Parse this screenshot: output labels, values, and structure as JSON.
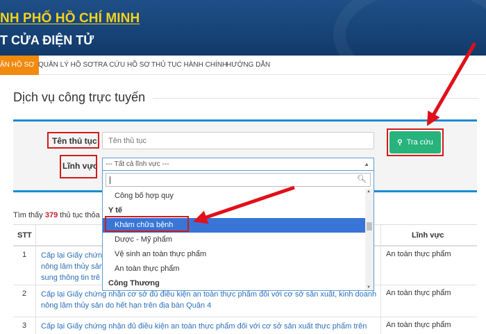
{
  "header": {
    "line1": "NH PHỐ HỒ CHÍ MINH",
    "line2": "T CỬA ĐIỆN TỬ"
  },
  "nav": {
    "items": [
      "ẬN HỒ SƠ",
      "QUẢN LÝ HỒ SƠ",
      "TRA CỨU HỒ SƠ",
      "THỦ TỤC HÀNH CHÍNH",
      "HƯỚNG DẪN"
    ],
    "active_color": "#f18a0e"
  },
  "page_title": "Dịch vụ công trực tuyến",
  "search": {
    "procedure_label": "Tên thủ tục",
    "procedure_placeholder": "Tên thủ tục",
    "field_label": "Lĩnh vực",
    "field_selected": "--- Tất cả lĩnh vực ---",
    "button_label": "Tra cứu",
    "button_color": "#27b37b"
  },
  "dropdown": {
    "items": [
      {
        "type": "option",
        "label": "Công bố hợp quy"
      },
      {
        "type": "group",
        "label": "Y tế"
      },
      {
        "type": "option",
        "label": "Khám chữa bệnh",
        "selected": true
      },
      {
        "type": "option",
        "label": "Dược - Mỹ phẩm"
      },
      {
        "type": "option",
        "label": "Vệ sinh an toàn thực phẩm"
      },
      {
        "type": "option",
        "label": "An toàn thực phẩm"
      },
      {
        "type": "group",
        "label": "Công Thương"
      }
    ]
  },
  "results": {
    "prefix": "Tìm thấy ",
    "count": "379",
    "suffix": " thủ tục thỏa"
  },
  "table": {
    "headers": {
      "stt": "STT",
      "field": "Lĩnh vực"
    },
    "rows": [
      {
        "stt": "1",
        "name": "Cấp lại Giấy chứng nhận cơ sở đủ điều kiện an toàn thực phẩm đối với cơ sở sản xuất, kinh doanh nông lâm thủy sản... sung thông tin trê...",
        "name_visible": [
          "Cấp lại Giấy chứng nh",
          "nông lâm thủy sản",
          "sung thông tin trê"
        ],
        "field": "An toàn thực phẩm"
      },
      {
        "stt": "2",
        "name_lines": [
          "Cấp lại Giấy chứng nhận cơ sở đủ điều kiện an toàn thực phẩm đối với cơ sở sản xuất, kinh doanh",
          "nông lâm thủy sản do hết hạn trên địa bàn Quận 4"
        ],
        "field": "An toàn thực phẩm"
      },
      {
        "stt": "3",
        "name_lines": [
          "Cấp lại Giấy chứng nhận đủ điều kiện an toàn thực phẩm đối với cơ sở sản xuất thực phẩm trên địa"
        ],
        "field": "An toàn thực phẩm"
      }
    ]
  },
  "annotation_color": "#d21a1a"
}
